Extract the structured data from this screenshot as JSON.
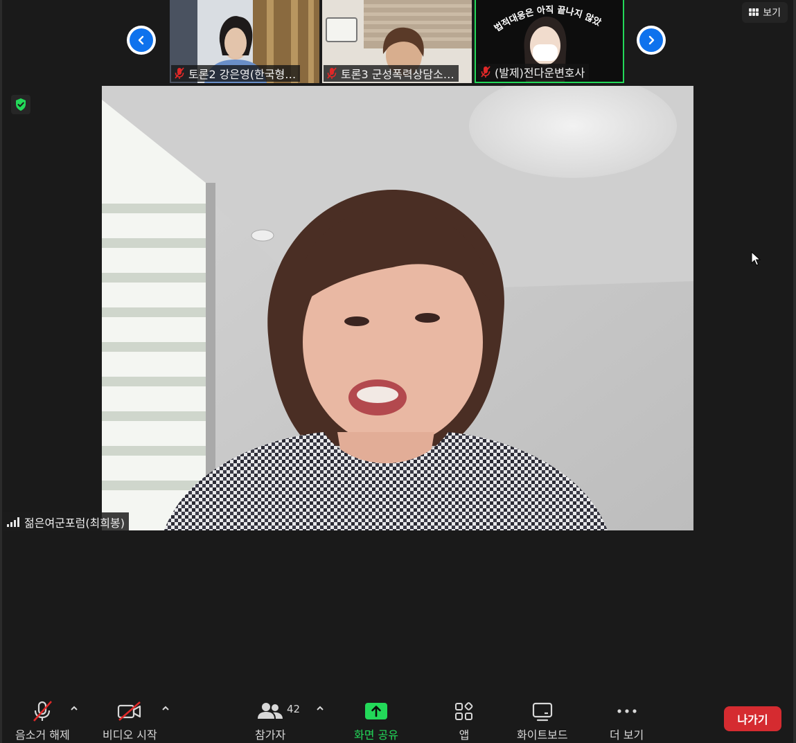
{
  "header": {
    "view_label": "보기"
  },
  "thumbnails": [
    {
      "name": "토론2 강은영(한국형…",
      "muted": true
    },
    {
      "name": "토론3 군성폭력상담소…",
      "muted": true
    },
    {
      "name": "(발제)전다운변호사",
      "muted": true,
      "active_speaker": true,
      "banner": "법적대응은 아직 끝나지 않았다"
    }
  ],
  "main_video": {
    "speaker_name": "젊은여군포럼(최희봉)"
  },
  "toolbar": {
    "mute_label": "음소거 해제",
    "video_label": "비디오 시작",
    "participants_label": "참가자",
    "participants_count": "42",
    "share_label": "화면 공유",
    "apps_label": "앱",
    "whiteboard_label": "화이트보드",
    "more_label": "더 보기",
    "leave_label": "나가기"
  },
  "colors": {
    "background": "#1a1a1a",
    "accent_blue": "#0e72ed",
    "share_green": "#23d959",
    "leave_red": "#d52b30",
    "muted_red": "#e02828",
    "security_green": "#23d959"
  },
  "icons": [
    "grid-icon",
    "shield-icon",
    "chevron-left-icon",
    "chevron-right-icon",
    "muted-mic-icon",
    "signal-icon",
    "mic-off-icon",
    "video-off-icon",
    "participants-icon",
    "share-screen-icon",
    "apps-icon",
    "whiteboard-icon",
    "more-icon",
    "caret-up-icon",
    "cursor-icon"
  ]
}
